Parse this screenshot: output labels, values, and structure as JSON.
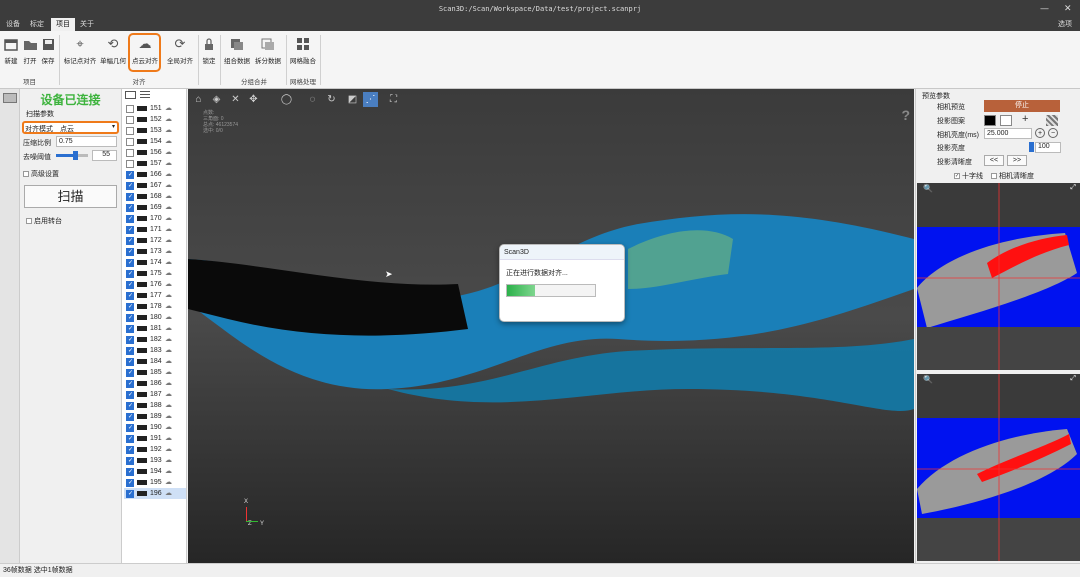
{
  "titlebar": {
    "title": "Scan3D:/Scan/Workspace/Data/test/project.scanprj",
    "minimize": "—",
    "close": "✕"
  },
  "menubar": {
    "tabs": [
      "设备",
      "标定",
      "项目",
      "关于"
    ],
    "active_tab": "项目",
    "options": "选项"
  },
  "ribbon": {
    "buttons": [
      {
        "label": "新建",
        "icon": "new-file-icon"
      },
      {
        "label": "打开",
        "icon": "open-folder-icon"
      },
      {
        "label": "保存",
        "icon": "save-icon"
      },
      {
        "label": "标记点对齐",
        "icon": "target-icon"
      },
      {
        "label": "单幅几何",
        "icon": "geometry-icon"
      },
      {
        "label": "点云对齐",
        "icon": "cloud-align-icon"
      },
      {
        "label": "全局对齐",
        "icon": "global-align-icon"
      },
      {
        "label": "锁定",
        "icon": "lock-icon"
      },
      {
        "label": "组合数据",
        "icon": "combine-icon"
      },
      {
        "label": "拆分数据",
        "icon": "split-icon"
      },
      {
        "label": "网格融合",
        "icon": "mesh-icon"
      }
    ],
    "groups": [
      "项目",
      "对齐",
      "分组合并",
      "网格处理"
    ]
  },
  "scan_panel": {
    "status": "设备已连接",
    "section": "扫描参数",
    "align_label": "对齐模式",
    "align_value": "点云",
    "compress_label": "压缩比例",
    "compress_value": "0.75",
    "denoise_label": "去噪阈值",
    "denoise_value": "55",
    "denoise_level": 0.6,
    "advanced": "高级设置",
    "scan_button": "扫描",
    "turntable": "启用转台"
  },
  "frames": [
    {
      "id": "151",
      "checked": false
    },
    {
      "id": "152",
      "checked": false
    },
    {
      "id": "153",
      "checked": false
    },
    {
      "id": "154",
      "checked": false
    },
    {
      "id": "156",
      "checked": false
    },
    {
      "id": "157",
      "checked": false
    },
    {
      "id": "166",
      "checked": true
    },
    {
      "id": "167",
      "checked": true
    },
    {
      "id": "168",
      "checked": true
    },
    {
      "id": "169",
      "checked": true
    },
    {
      "id": "170",
      "checked": true
    },
    {
      "id": "171",
      "checked": true
    },
    {
      "id": "172",
      "checked": true
    },
    {
      "id": "173",
      "checked": true
    },
    {
      "id": "174",
      "checked": true
    },
    {
      "id": "175",
      "checked": true
    },
    {
      "id": "176",
      "checked": true
    },
    {
      "id": "177",
      "checked": true
    },
    {
      "id": "178",
      "checked": true
    },
    {
      "id": "180",
      "checked": true
    },
    {
      "id": "181",
      "checked": true
    },
    {
      "id": "182",
      "checked": true
    },
    {
      "id": "183",
      "checked": true
    },
    {
      "id": "184",
      "checked": true
    },
    {
      "id": "185",
      "checked": true
    },
    {
      "id": "186",
      "checked": true
    },
    {
      "id": "187",
      "checked": true
    },
    {
      "id": "188",
      "checked": true
    },
    {
      "id": "189",
      "checked": true
    },
    {
      "id": "190",
      "checked": true
    },
    {
      "id": "191",
      "checked": true
    },
    {
      "id": "192",
      "checked": true
    },
    {
      "id": "193",
      "checked": true
    },
    {
      "id": "194",
      "checked": true
    },
    {
      "id": "195",
      "checked": true
    },
    {
      "id": "196",
      "checked": true,
      "selected": true
    }
  ],
  "viewport": {
    "stats": [
      "点数:",
      "三角面: 0",
      "总点: 46123574",
      "选中: 0/0"
    ],
    "help": "?",
    "axes": [
      "X",
      "Y",
      "Z"
    ]
  },
  "dialog": {
    "title": "Scan3D",
    "message": "正在进行数据对齐...",
    "progress": 0.32
  },
  "right_panel": {
    "section": "预览参数",
    "camera_preview_label": "相机预览",
    "stop_button": "停止",
    "projection_pattern_label": "投影图案",
    "camera_brightness_label": "相机亮度(ms)",
    "camera_brightness_value": "25.000",
    "projection_brightness_label": "投影亮度",
    "projection_brightness_value": "100",
    "projection_sharpness_label": "投影清晰度",
    "prev_button": "<<",
    "next_button": ">>",
    "crosshair_label": "十字线",
    "camera_sharpness_label": "相机清晰度"
  },
  "status_bar": {
    "text": "36帧数据 选中1帧数据"
  },
  "colors": {
    "status_green": "#3db33d",
    "highlight_orange": "#ef7a1a",
    "stop_button": "#b8613a",
    "point_cloud_blue": "#1a7fb8"
  }
}
